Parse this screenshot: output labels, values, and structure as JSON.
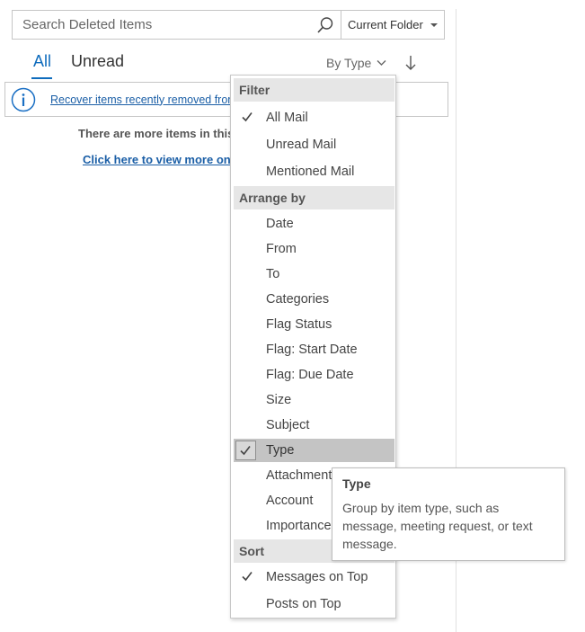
{
  "search": {
    "placeholder": "Search Deleted Items",
    "scope": "Current Folder"
  },
  "tabs": {
    "all": "All",
    "unread": "Unread"
  },
  "sort": {
    "by_label": "By Type"
  },
  "banner": {
    "text": "Recover items recently removed from this folder"
  },
  "list": {
    "more_items": "There are more items in this folder on the server",
    "view_more": "Click here to view more on Microsoft Exchange"
  },
  "menu": {
    "filter_header": "Filter",
    "filter_items": [
      {
        "label": "All Mail",
        "checked": true
      },
      {
        "label": "Unread Mail",
        "checked": false
      },
      {
        "label": "Mentioned Mail",
        "checked": false
      }
    ],
    "arrange_header": "Arrange by",
    "arrange_items": [
      {
        "label": "Date"
      },
      {
        "label": "From"
      },
      {
        "label": "To"
      },
      {
        "label": "Categories"
      },
      {
        "label": "Flag Status"
      },
      {
        "label": "Flag: Start Date"
      },
      {
        "label": "Flag: Due Date"
      },
      {
        "label": "Size"
      },
      {
        "label": "Subject"
      },
      {
        "label": "Type",
        "checked": true
      },
      {
        "label": "Attachments"
      },
      {
        "label": "Account"
      },
      {
        "label": "Importance"
      }
    ],
    "sort_header": "Sort",
    "sort_items": [
      {
        "label": "Messages on Top",
        "checked": true
      },
      {
        "label": "Posts on Top",
        "checked": false
      }
    ]
  },
  "tooltip": {
    "title": "Type",
    "body": "Group by item type, such as message, meeting request, or text message."
  },
  "colors": {
    "accent": "#0f6cbd",
    "link": "#1a5ea6",
    "header_bg": "#e6e6e6",
    "selected_bg": "#c4c4c4"
  },
  "icons": {
    "search": "search-icon",
    "info": "info-icon",
    "check": "check-icon",
    "chevron": "chevron-down-icon",
    "sort": "sort-arrow-down-icon"
  }
}
